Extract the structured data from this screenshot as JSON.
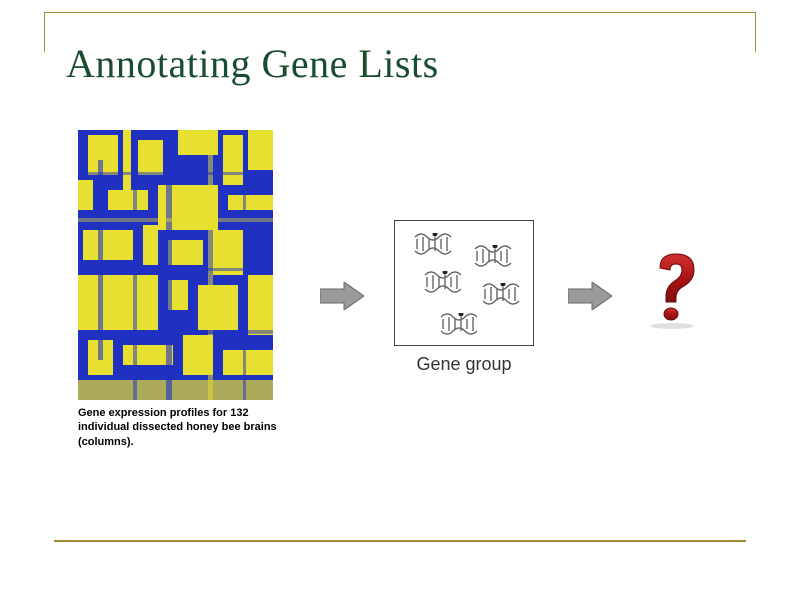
{
  "title": "Annotating Gene Lists",
  "heatmap_caption": "Gene expression profiles for 132 individual dissected honey bee brains (columns).",
  "gene_group_label": "Gene group",
  "icons": {
    "arrow": "arrow-right-icon",
    "question": "question-mark-icon",
    "helix": "dna-helix-icon"
  },
  "colors": {
    "title": "#1a4d2e",
    "border": "#a08b3a",
    "heatmap_primary": "#2030c0",
    "heatmap_secondary": "#e8e030",
    "question_red": "#b01818"
  }
}
